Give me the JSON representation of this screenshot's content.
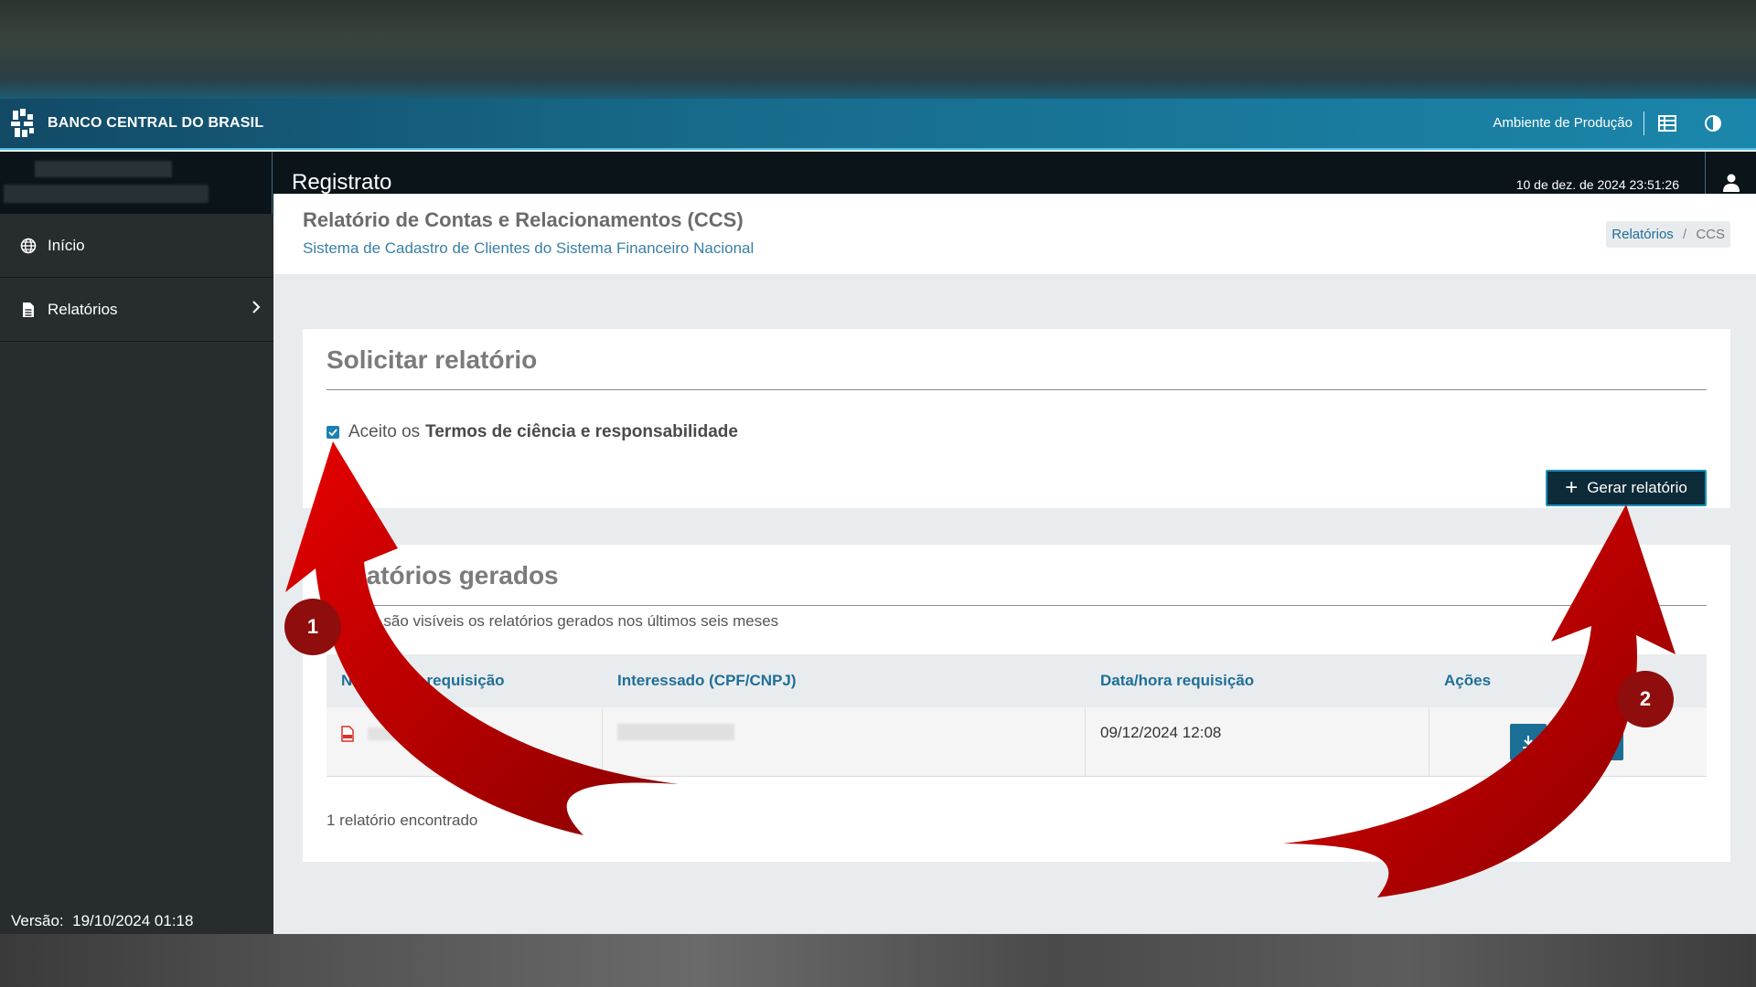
{
  "topbar": {
    "logo_text": "BANCO CENTRAL DO BRASIL",
    "environment": "Ambiente de Produção"
  },
  "header": {
    "app_title": "Registrato",
    "datetime": "10 de dez. de 2024 23:51:26"
  },
  "sidebar": {
    "items": [
      {
        "label": "Início",
        "icon": "globe-icon"
      },
      {
        "label": "Relatórios",
        "icon": "document-icon"
      }
    ],
    "version_label": "Versão:",
    "version_value": "19/10/2024 01:18"
  },
  "page": {
    "title": "Relatório de Contas e Relacionamentos (CCS)",
    "subtitle": "Sistema de Cadastro de Clientes do Sistema Financeiro Nacional",
    "breadcrumb": {
      "link": "Relatórios",
      "separator": "/",
      "current": "CCS"
    }
  },
  "request_card": {
    "title": "Solicitar relatório",
    "terms_prefix": "Aceito os",
    "terms_bold": "Termos de ciência e responsabilidade",
    "terms_checked": true,
    "generate_button": "Gerar relatório"
  },
  "reports_card": {
    "title": "Relatórios gerados",
    "description": "Apenas são visíveis os relatórios gerados nos últimos seis meses",
    "columns": [
      "Número da requisição",
      "Interessado (CPF/CNPJ)",
      "Data/hora requisição",
      "Ações"
    ],
    "rows": [
      {
        "datetime": "09/12/2024 12:08"
      }
    ],
    "count_text": "1 relatório encontrado"
  },
  "annotations": {
    "step1": "1",
    "step2": "2"
  },
  "colors": {
    "topbar_accent": "#49c0e6",
    "primary": "#1b6f96",
    "annotation_red": "#c00000"
  }
}
